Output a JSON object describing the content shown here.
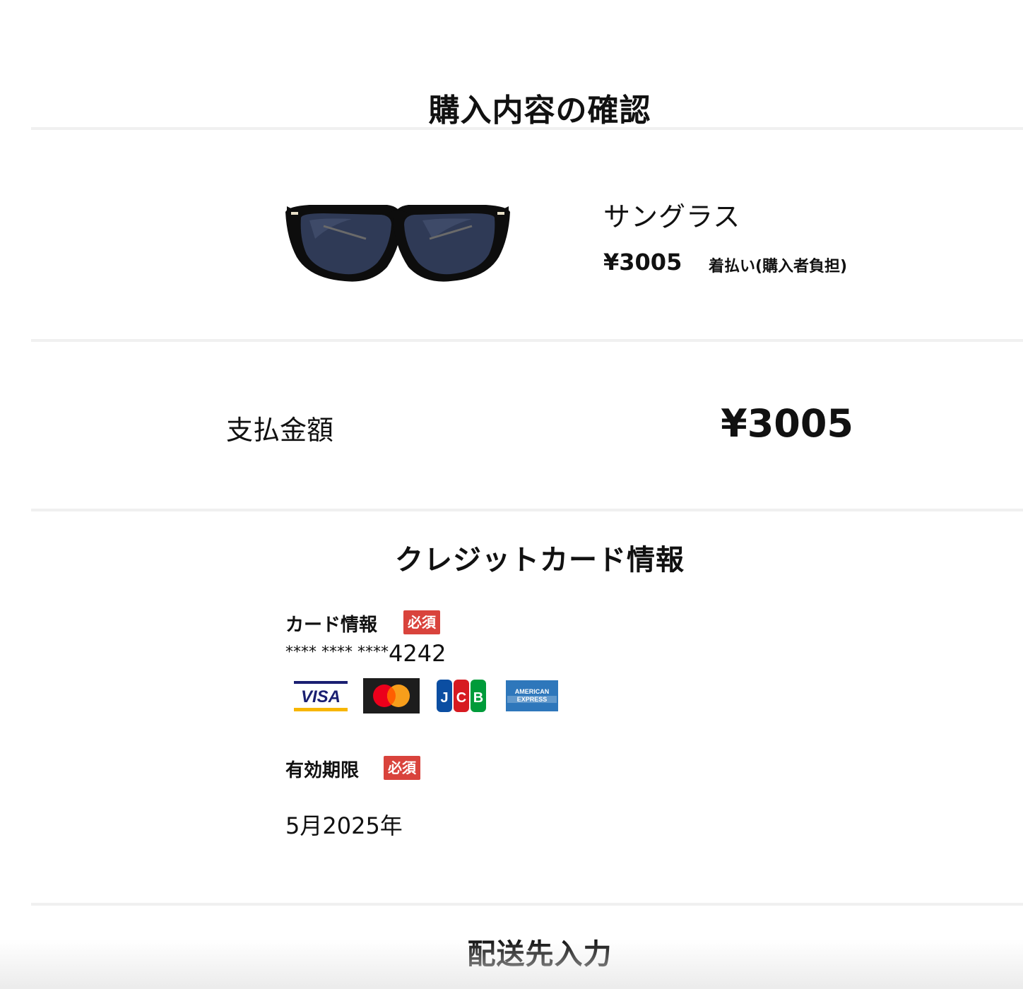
{
  "page_title": "購入内容の確認",
  "product": {
    "image_alt": "sunglasses",
    "name": "サングラス",
    "price": "¥3005",
    "shipping": "着払い(購入者負担)"
  },
  "total": {
    "label": "支払金額",
    "value": "¥3005"
  },
  "credit_card": {
    "section_title": "クレジットカード情報",
    "card_field": {
      "label": "カード情報",
      "required_badge": "必須",
      "masked_prefix": "**** **** ****",
      "last_digits": "4242"
    },
    "brands": [
      {
        "name": "visa-logo",
        "text": "VISA"
      },
      {
        "name": "mastercard-logo",
        "text": ""
      },
      {
        "name": "jcb-logo",
        "text": "JCB"
      },
      {
        "name": "amex-logo",
        "text": "AMERICAN EXPRESS"
      }
    ],
    "expiry_field": {
      "label": "有効期限",
      "required_badge": "必須",
      "value": "5月2025年"
    }
  },
  "shipping_section": {
    "title": "配送先入力"
  },
  "colors": {
    "badge": "#d9433c",
    "divider": "#f0f0f0",
    "visa_blue": "#1a1f71",
    "visa_gold": "#f7b600",
    "mc_red": "#eb001b",
    "mc_orange": "#f79e1b",
    "jcb_blue": "#0b4ea2",
    "jcb_red": "#d71a21",
    "jcb_green": "#009b3a",
    "amex_blue": "#2e77bb"
  }
}
